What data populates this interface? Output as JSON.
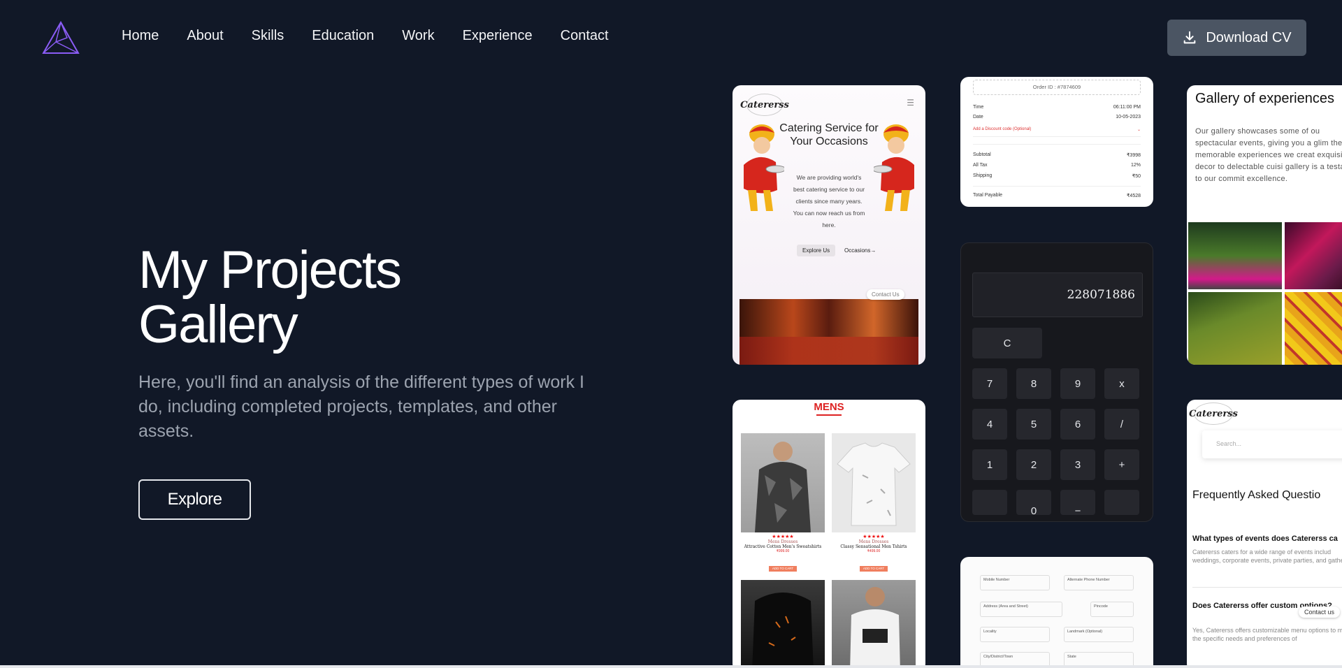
{
  "nav": {
    "items": [
      "Home",
      "About",
      "Skills",
      "Education",
      "Work",
      "Experience",
      "Contact"
    ],
    "download_label": "Download CV"
  },
  "hero": {
    "title_line1": "My Projects",
    "title_line2": "Gallery",
    "subtitle": "Here, you'll find an analysis of the different types of work I do, including completed projects, templates, and other assets.",
    "explore_label": "Explore"
  },
  "cards": {
    "catering": {
      "logo": "Catererss",
      "title": "Catering Service for Your Occasions",
      "text": "We are providing world's best catering service to our clients since many years. You can now reach us from here.",
      "btn_explore": "Explore Us",
      "btn_occasions": "Occasions→",
      "contact": "Contact Us"
    },
    "order": {
      "order_id": "Order ID : #7874609",
      "time_label": "Time",
      "time_value": "06:11:00 PM",
      "date_label": "Date",
      "date_value": "10-05-2023",
      "discount": "Add a Discount code (Optional)",
      "subtotal_label": "Subtotal",
      "subtotal_value": "₹3998",
      "tax_label": "All Tax",
      "tax_value": "12%",
      "shipping_label": "Shipping",
      "shipping_value": "₹50",
      "total_label": "Total Payable",
      "total_value": "₹4528"
    },
    "gallery": {
      "title": "Gallery of experiences",
      "text": "Our gallery showcases some of ou spectacular events, giving you a glim the memorable experiences we creat exquisite decor to delectable cuisi gallery is a testament to our commit excellence."
    },
    "calculator": {
      "display": "228071886",
      "keys": [
        "C",
        "7",
        "8",
        "9",
        "x",
        "4",
        "5",
        "6",
        "/",
        "1",
        "2",
        "3",
        "+",
        "",
        "0",
        "−",
        ""
      ]
    },
    "mens": {
      "title": "MENS",
      "products": [
        {
          "brand": "Mens Dresses",
          "name": "Attractive Cotton Men's Sweatshirts",
          "price": "₹999.00",
          "cart": "ADD TO CART"
        },
        {
          "brand": "Mens Dresses",
          "name": "Classy Sensational Men Tshirts",
          "price": "₹499.00",
          "cart": "ADD TO CART"
        }
      ]
    },
    "faq": {
      "logo": "Catererss",
      "search_placeholder": "Search...",
      "heading": "Frequently Asked Questio",
      "q1": "What types of events does Catererss ca",
      "a1": "Catererss caters for a wide range of events includ weddings, corporate events, private parties, and gatherings.",
      "q2": "Does Catererss offer custom options?",
      "a2": "Yes, Catererss offers customizable menu options to meet the specific needs and preferences of",
      "contact": "Contact us"
    },
    "form": {
      "fields": [
        "Mobile Number",
        "Alternate Phone Number",
        "Address (Area and Street)",
        "Pincode",
        "Locality",
        "Landmark (Optional)",
        "City/District/Town",
        "State"
      ]
    }
  },
  "colors": {
    "background": "#111827",
    "button_gray": "#4b5563",
    "subtitle_gray": "#9ca3af",
    "logo_purple": "#8b5cf6"
  }
}
